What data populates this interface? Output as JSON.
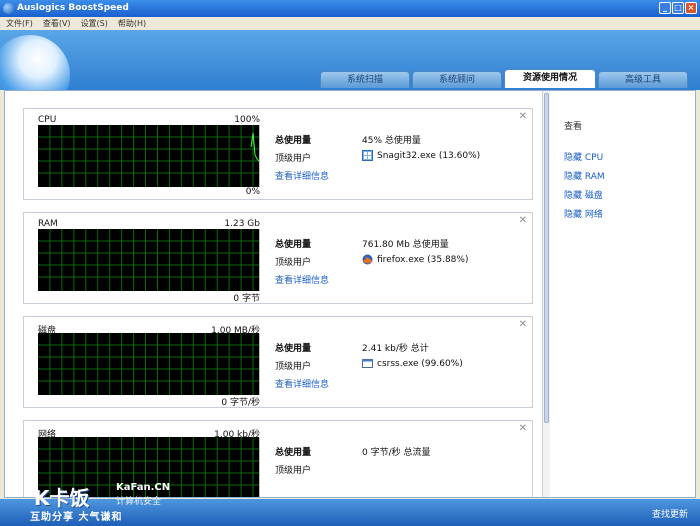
{
  "window": {
    "title": "Auslogics BoostSpeed"
  },
  "menu": [
    "文件(F)",
    "查看(V)",
    "设置(S)",
    "帮助(H)"
  ],
  "tabs": [
    {
      "label": "系统扫描"
    },
    {
      "label": "系统顾问"
    },
    {
      "label": "资源使用情况"
    },
    {
      "label": "高级工具"
    }
  ],
  "panels": [
    {
      "graph_label": "CPU",
      "graph_max": "100%",
      "graph_min": "0%",
      "total_label": "总使用量",
      "total_value": "45% 总使用量",
      "top_label": "顶级用户",
      "top_process": "Snagit32.exe (13.60%)",
      "top_icon": "snagit-icon",
      "details_link": "查看详细信息"
    },
    {
      "graph_label": "RAM",
      "graph_max": "1.23 Gb",
      "graph_min": "0 字节",
      "total_label": "总使用量",
      "total_value": "761.80 Mb 总使用量",
      "top_label": "顶级用户",
      "top_process": "firefox.exe (35.88%)",
      "top_icon": "firefox-icon",
      "details_link": "查看详细信息"
    },
    {
      "graph_label": "磁盘",
      "graph_max": "1.00 MB/秒",
      "graph_min": "0 字节/秒",
      "total_label": "总使用量",
      "total_value": "2.41 kb/秒 总计",
      "top_label": "顶级用户",
      "top_process": "csrss.exe (99.60%)",
      "top_icon": "window-icon",
      "details_link": "查看详细信息"
    },
    {
      "graph_label": "网络",
      "graph_max": "1.00 kb/秒",
      "graph_min": "",
      "total_label": "总使用量",
      "total_value": "0 字节/秒 总流量",
      "top_label": "顶级用户",
      "top_process": "",
      "top_icon": "",
      "details_link": ""
    }
  ],
  "side": {
    "title": "查看",
    "links": [
      "隐藏 CPU",
      "隐藏 RAM",
      "隐藏 磁盘",
      "隐藏 网络"
    ]
  },
  "status": {
    "check_updates": "查找更新"
  },
  "watermark": {
    "logo": "K卡饭",
    "site": "KaFan.CN",
    "sub": "计算机安全",
    "slogan": "互助分享  大气谦和"
  }
}
